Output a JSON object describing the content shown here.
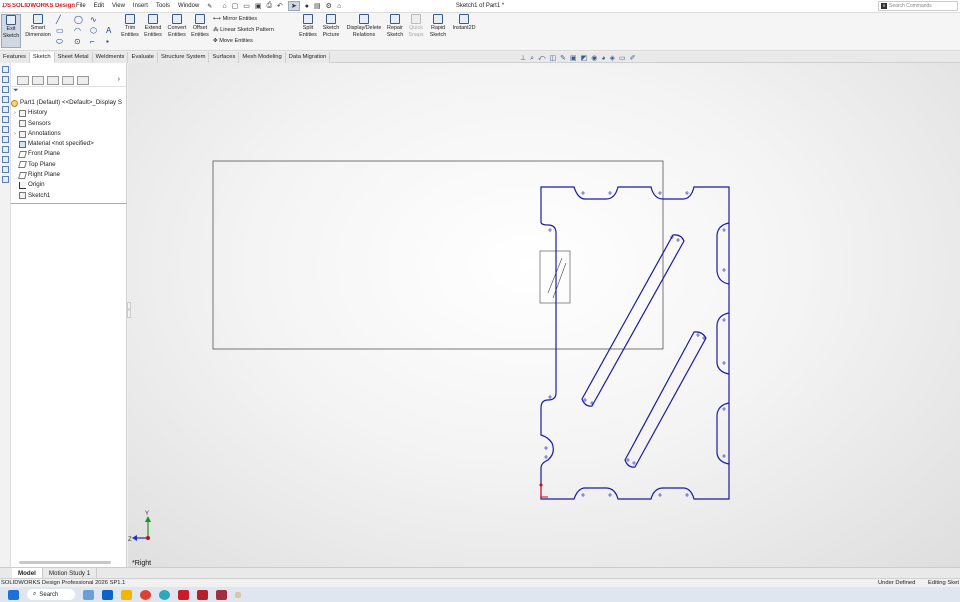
{
  "app": {
    "logo": "SOLIDWORKS Design",
    "menu": [
      "File",
      "Edit",
      "View",
      "Insert",
      "Tools",
      "Window"
    ],
    "doc_title": "Sketch1 of Part1 *",
    "search_placeholder": "Search Commands"
  },
  "ribbon": {
    "exit_sketch": "Exit Sketch",
    "smart_dimension": "Smart Dimension",
    "trim_entities": "Trim Entities",
    "extend_entities": "Extend Entities",
    "convert_entities": "Convert Entities",
    "offset_entities": "Offset Entities",
    "mirror_entities": "Mirror Entities",
    "linear_sketch_pattern": "Linear Sketch Pattern",
    "move_entities": "Move Entities",
    "split_entities": "Split Entities",
    "sketch_picture": "Sketch Picture",
    "display_delete_relations": "Display/Delete Relations",
    "repair_sketch": "Repair Sketch",
    "quick_snaps": "Quick Snaps",
    "rapid_sketch": "Rapid Sketch",
    "instant2d": "Instant2D"
  },
  "tabs": [
    "Features",
    "Sketch",
    "Sheet Metal",
    "Weldments",
    "Evaluate",
    "Structure System",
    "Surfaces",
    "Mesh Modeling",
    "Data Migration"
  ],
  "active_tab": "Sketch",
  "feature_tree": {
    "root": "Part1 (Default) <<Default>_Display S",
    "items": [
      "History",
      "Sensors",
      "Annotations",
      "Material <not specified>",
      "Front Plane",
      "Top Plane",
      "Right Plane",
      "Origin",
      "Sketch1"
    ]
  },
  "viewport": {
    "view_name": "*Right",
    "axis_z": "Z",
    "axis_y": "Y"
  },
  "bottom_tabs": [
    "Model",
    "Motion Study 1"
  ],
  "status": {
    "product": "SOLIDWORKS Design Professional 2026 SP1.1",
    "state": "Under Defined",
    "mode": "Editing Sket"
  },
  "taskbar": {
    "search": "Search"
  },
  "colors": {
    "sketch_line": "#1a1aa8",
    "brand": "#d71921"
  }
}
